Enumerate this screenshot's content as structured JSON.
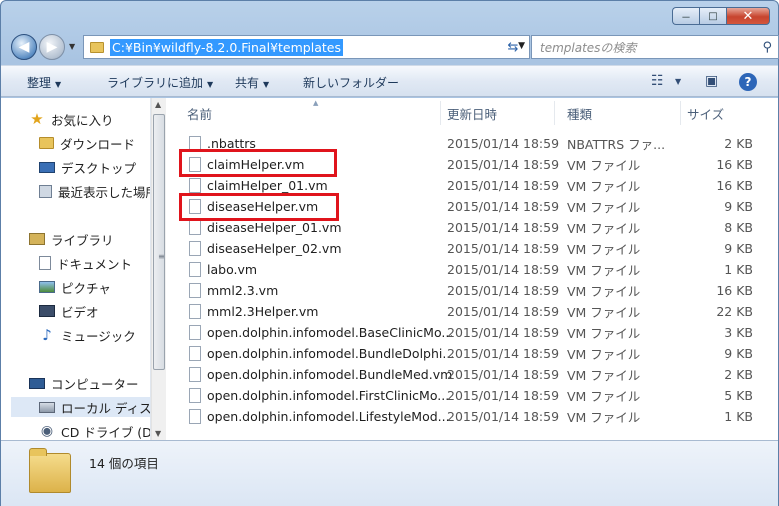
{
  "window": {
    "caption_buttons": [
      "－",
      "□",
      "✕"
    ]
  },
  "address_bar": {
    "path": "C:¥Bin¥wildfly-8.2.0.Final¥templates",
    "search_placeholder": "templatesの検索"
  },
  "toolbar": {
    "organize": "整理",
    "add_to_library": "ライブラリに追加",
    "share": "共有",
    "new_folder": "新しいフォルダー"
  },
  "nav_pane": {
    "favorites": "お気に入り",
    "downloads": "ダウンロード",
    "desktop": "デスクトップ",
    "recent": "最近表示した場所",
    "libraries": "ライブラリ",
    "documents": "ドキュメント",
    "pictures": "ピクチャ",
    "videos": "ビデオ",
    "music": "ミュージック",
    "computer": "コンピューター",
    "local_disk": "ローカル ディスク",
    "cd_drive": "CD ドライブ (D"
  },
  "columns": {
    "name": "名前",
    "modified": "更新日時",
    "type": "種類",
    "size": "サイズ"
  },
  "files": [
    {
      "name": ".nbattrs",
      "date": "2015/01/14 18:59",
      "type": "NBATTRS ファ...",
      "size": "2 KB"
    },
    {
      "name": "claimHelper.vm",
      "date": "2015/01/14 18:59",
      "type": "VM ファイル",
      "size": "16 KB"
    },
    {
      "name": "claimHelper_01.vm",
      "date": "2015/01/14 18:59",
      "type": "VM ファイル",
      "size": "16 KB"
    },
    {
      "name": "diseaseHelper.vm",
      "date": "2015/01/14 18:59",
      "type": "VM ファイル",
      "size": "9 KB"
    },
    {
      "name": "diseaseHelper_01.vm",
      "date": "2015/01/14 18:59",
      "type": "VM ファイル",
      "size": "8 KB"
    },
    {
      "name": "diseaseHelper_02.vm",
      "date": "2015/01/14 18:59",
      "type": "VM ファイル",
      "size": "9 KB"
    },
    {
      "name": "labo.vm",
      "date": "2015/01/14 18:59",
      "type": "VM ファイル",
      "size": "1 KB"
    },
    {
      "name": "mml2.3.vm",
      "date": "2015/01/14 18:59",
      "type": "VM ファイル",
      "size": "16 KB"
    },
    {
      "name": "mml2.3Helper.vm",
      "date": "2015/01/14 18:59",
      "type": "VM ファイル",
      "size": "22 KB"
    },
    {
      "name": "open.dolphin.infomodel.BaseClinicMo...",
      "date": "2015/01/14 18:59",
      "type": "VM ファイル",
      "size": "3 KB"
    },
    {
      "name": "open.dolphin.infomodel.BundleDolphi...",
      "date": "2015/01/14 18:59",
      "type": "VM ファイル",
      "size": "9 KB"
    },
    {
      "name": "open.dolphin.infomodel.BundleMed.vm",
      "date": "2015/01/14 18:59",
      "type": "VM ファイル",
      "size": "2 KB"
    },
    {
      "name": "open.dolphin.infomodel.FirstClinicMo...",
      "date": "2015/01/14 18:59",
      "type": "VM ファイル",
      "size": "5 KB"
    },
    {
      "name": "open.dolphin.infomodel.LifestyleMod...",
      "date": "2015/01/14 18:59",
      "type": "VM ファイル",
      "size": "1 KB"
    }
  ],
  "highlighted_files": [
    "claimHelper.vm",
    "diseaseHelper.vm"
  ],
  "status": {
    "item_count": "14 個の項目"
  },
  "colors": {
    "highlight_box": "#e0141c",
    "address_selection": "#3399ff"
  }
}
